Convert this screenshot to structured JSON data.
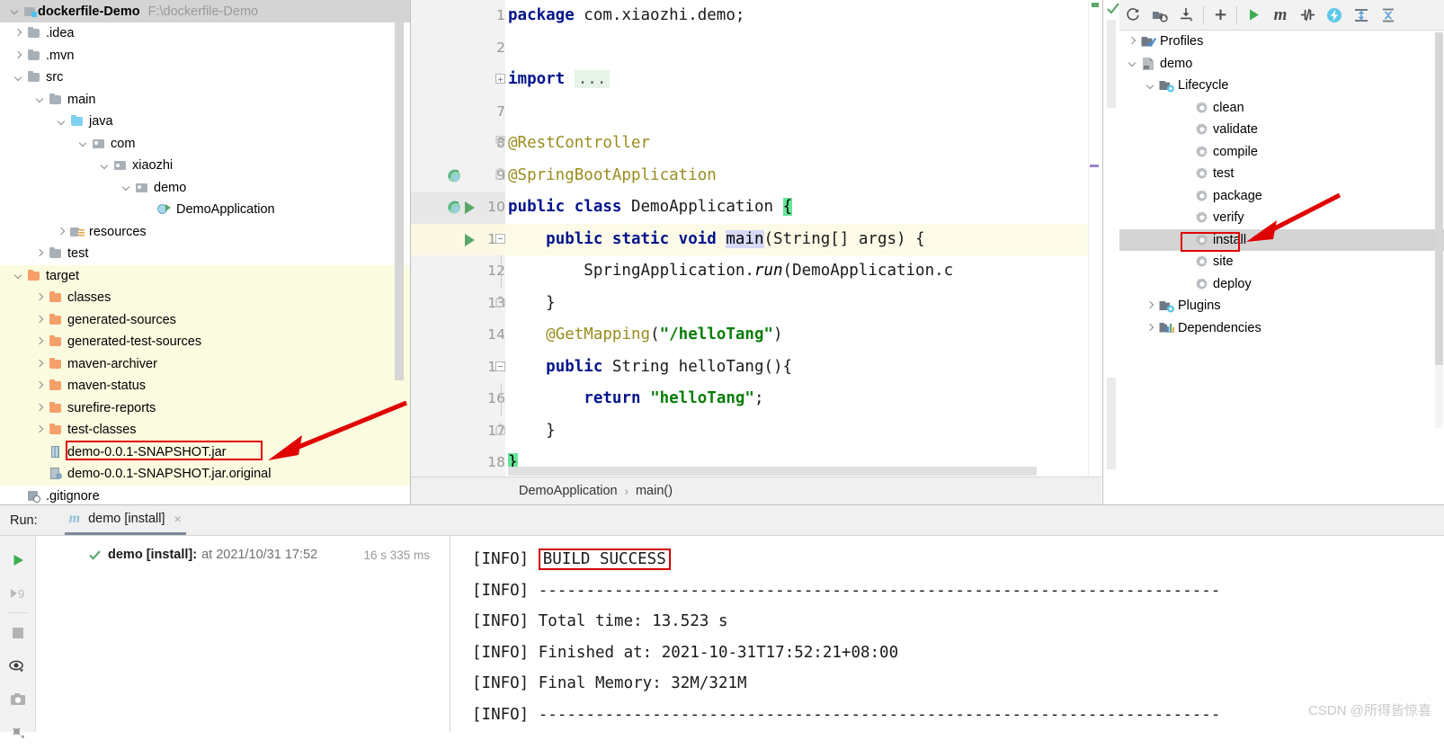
{
  "project": {
    "title": "dockerfile-Demo",
    "path": "F:\\dockerfile-Demo",
    "tree": [
      {
        "label": ".idea",
        "depth": 1,
        "arrow": "collapsed",
        "icon": "folder",
        "highlight": false
      },
      {
        "label": ".mvn",
        "depth": 1,
        "arrow": "collapsed",
        "icon": "folder",
        "highlight": false
      },
      {
        "label": "src",
        "depth": 1,
        "arrow": "expanded",
        "icon": "folder",
        "highlight": false
      },
      {
        "label": "main",
        "depth": 2,
        "arrow": "expanded",
        "icon": "folder",
        "highlight": false
      },
      {
        "label": "java",
        "depth": 3,
        "arrow": "expanded",
        "icon": "folder-src",
        "highlight": false
      },
      {
        "label": "com",
        "depth": 4,
        "arrow": "expanded",
        "icon": "pkg",
        "highlight": false
      },
      {
        "label": "xiaozhi",
        "depth": 5,
        "arrow": "expanded",
        "icon": "pkg",
        "highlight": false
      },
      {
        "label": "demo",
        "depth": 6,
        "arrow": "expanded",
        "icon": "pkg",
        "highlight": false
      },
      {
        "label": "DemoApplication",
        "depth": 7,
        "arrow": "none",
        "icon": "cls",
        "highlight": false
      },
      {
        "label": "resources",
        "depth": 3,
        "arrow": "collapsed",
        "icon": "res",
        "highlight": false
      },
      {
        "label": "test",
        "depth": 2,
        "arrow": "collapsed",
        "icon": "folder",
        "highlight": false
      },
      {
        "label": "target",
        "depth": 1,
        "arrow": "expanded",
        "icon": "folder-out",
        "highlight": true
      },
      {
        "label": "classes",
        "depth": 2,
        "arrow": "collapsed",
        "icon": "folder-out",
        "highlight": true
      },
      {
        "label": "generated-sources",
        "depth": 2,
        "arrow": "collapsed",
        "icon": "folder-out",
        "highlight": true
      },
      {
        "label": "generated-test-sources",
        "depth": 2,
        "arrow": "collapsed",
        "icon": "folder-out",
        "highlight": true
      },
      {
        "label": "maven-archiver",
        "depth": 2,
        "arrow": "collapsed",
        "icon": "folder-out",
        "highlight": true
      },
      {
        "label": "maven-status",
        "depth": 2,
        "arrow": "collapsed",
        "icon": "folder-out",
        "highlight": true
      },
      {
        "label": "surefire-reports",
        "depth": 2,
        "arrow": "collapsed",
        "icon": "folder-out",
        "highlight": true
      },
      {
        "label": "test-classes",
        "depth": 2,
        "arrow": "collapsed",
        "icon": "folder-out",
        "highlight": true
      },
      {
        "label": "demo-0.0.1-SNAPSHOT.jar",
        "depth": 2,
        "arrow": "none",
        "icon": "jar",
        "highlight": true
      },
      {
        "label": "demo-0.0.1-SNAPSHOT.jar.original",
        "depth": 2,
        "arrow": "none",
        "icon": "fgen",
        "highlight": true
      },
      {
        "label": ".gitignore",
        "depth": 1,
        "arrow": "none",
        "icon": "git",
        "highlight": false
      }
    ]
  },
  "editor": {
    "lines": [
      {
        "num": "1",
        "tokens": [
          {
            "t": "package",
            "c": "kw"
          },
          {
            "t": " com.xiaozhi.demo;",
            "c": "plain"
          }
        ]
      },
      {
        "num": "2",
        "tokens": []
      },
      {
        "num": "3",
        "tokens": [
          {
            "t": "import",
            "c": "kw"
          },
          {
            "t": " ",
            "c": "plain"
          },
          {
            "t": "...",
            "c": "ellipsis"
          }
        ],
        "fold": "plus"
      },
      {
        "num": "7",
        "tokens": []
      },
      {
        "num": "8",
        "tokens": [
          {
            "t": "@RestController",
            "c": "ann"
          }
        ],
        "foldcap": "start"
      },
      {
        "num": "9",
        "tokens": [
          {
            "t": "@SpringBootApplication",
            "c": "ann"
          }
        ],
        "gutterIcon": "bean",
        "foldcap": "mid"
      },
      {
        "num": "10",
        "tokens": [
          {
            "t": "public class",
            "c": "kw"
          },
          {
            "t": " DemoApplication ",
            "c": "plain"
          },
          {
            "t": "{",
            "c": "brace-hl"
          }
        ],
        "gutterIcon": "bean-run",
        "activeGutter": true
      },
      {
        "num": "11",
        "tokens": [
          {
            "t": "    ",
            "c": "plain"
          },
          {
            "t": "public static void",
            "c": "kw"
          },
          {
            "t": " ",
            "c": "plain"
          },
          {
            "t": "main",
            "c": "sel"
          },
          {
            "t": "(String[] args) {",
            "c": "plain"
          }
        ],
        "gutterIcon": "run",
        "highlight": true,
        "fold": "minus"
      },
      {
        "num": "12",
        "tokens": [
          {
            "t": "        SpringApplication.",
            "c": "plain"
          },
          {
            "t": "run",
            "c": "ital"
          },
          {
            "t": "(DemoApplication.c",
            "c": "plain"
          }
        ]
      },
      {
        "num": "13",
        "tokens": [
          {
            "t": "    }",
            "c": "plain"
          }
        ],
        "foldcap": "end"
      },
      {
        "num": "14",
        "tokens": [
          {
            "t": "    ",
            "c": "plain"
          },
          {
            "t": "@GetMapping",
            "c": "ann"
          },
          {
            "t": "(",
            "c": "plain"
          },
          {
            "t": "\"/helloTang\"",
            "c": "str"
          },
          {
            "t": ")",
            "c": "plain"
          }
        ]
      },
      {
        "num": "15",
        "tokens": [
          {
            "t": "    ",
            "c": "plain"
          },
          {
            "t": "public",
            "c": "kw"
          },
          {
            "t": " String helloTang(){",
            "c": "plain"
          }
        ],
        "fold": "minus"
      },
      {
        "num": "16",
        "tokens": [
          {
            "t": "        ",
            "c": "plain"
          },
          {
            "t": "return",
            "c": "kw"
          },
          {
            "t": " ",
            "c": "plain"
          },
          {
            "t": "\"helloTang\"",
            "c": "str"
          },
          {
            "t": ";",
            "c": "plain"
          }
        ]
      },
      {
        "num": "17",
        "tokens": [
          {
            "t": "    }",
            "c": "plain"
          }
        ],
        "foldcap": "end"
      },
      {
        "num": "18",
        "tokens": [
          {
            "t": "}",
            "c": "brace-hl"
          }
        ]
      }
    ],
    "breadcrumb": {
      "class": "DemoApplication",
      "separator": "›",
      "method": "main()"
    }
  },
  "maven": {
    "toolbar": [
      {
        "name": "reload-all-maven-projects-icon"
      },
      {
        "name": "generate-sources-icon"
      },
      {
        "name": "download-sources-icon"
      },
      {
        "name": "add-maven-project-icon"
      },
      {
        "name": "run-maven-build-icon"
      },
      {
        "name": "execute-maven-goal-icon"
      },
      {
        "name": "toggle-skip-tests-icon"
      },
      {
        "name": "toggle-offline-mode-icon"
      },
      {
        "name": "expand-all-icon"
      },
      {
        "name": "collapse-all-icon"
      }
    ],
    "tree": [
      {
        "label": "Profiles",
        "depth": 1,
        "arrow": "collapsed",
        "icon": "profiles",
        "selected": false
      },
      {
        "label": "demo",
        "depth": 1,
        "arrow": "expanded",
        "icon": "maven",
        "selected": false
      },
      {
        "label": "Lifecycle",
        "depth": 2,
        "arrow": "expanded",
        "icon": "phase-dir",
        "selected": false
      },
      {
        "label": "clean",
        "depth": 4,
        "arrow": "none",
        "icon": "gear",
        "selected": false
      },
      {
        "label": "validate",
        "depth": 4,
        "arrow": "none",
        "icon": "gear",
        "selected": false
      },
      {
        "label": "compile",
        "depth": 4,
        "arrow": "none",
        "icon": "gear",
        "selected": false
      },
      {
        "label": "test",
        "depth": 4,
        "arrow": "none",
        "icon": "gear",
        "selected": false
      },
      {
        "label": "package",
        "depth": 4,
        "arrow": "none",
        "icon": "gear",
        "selected": false
      },
      {
        "label": "verify",
        "depth": 4,
        "arrow": "none",
        "icon": "gear",
        "selected": false
      },
      {
        "label": "install",
        "depth": 4,
        "arrow": "none",
        "icon": "gear",
        "selected": true
      },
      {
        "label": "site",
        "depth": 4,
        "arrow": "none",
        "icon": "gear",
        "selected": false
      },
      {
        "label": "deploy",
        "depth": 4,
        "arrow": "none",
        "icon": "gear",
        "selected": false
      },
      {
        "label": "Plugins",
        "depth": 2,
        "arrow": "collapsed",
        "icon": "phase-dir",
        "selected": false
      },
      {
        "label": "Dependencies",
        "depth": 2,
        "arrow": "collapsed",
        "icon": "deps",
        "selected": false
      }
    ]
  },
  "run": {
    "label": "Run:",
    "tab": {
      "icon_glyph": "m",
      "name": "demo [install]",
      "close": "×"
    },
    "side_buttons": [
      {
        "name": "rerun-button"
      },
      {
        "name": "rerun-failed-tests-button"
      },
      {
        "name": "stop-button"
      },
      {
        "name": "toggle-visibility-button"
      },
      {
        "name": "export-screenshot-button"
      },
      {
        "name": "thread-dump-button"
      }
    ],
    "tree_row": {
      "name": "demo [install]:",
      "at": "at 2021/10/31 17:52",
      "duration": "16 s 335 ms"
    },
    "console": [
      {
        "prefix": "[INFO] ",
        "text": "BUILD SUCCESS",
        "boxed": true
      },
      {
        "prefix": "[INFO] ",
        "text": "------------------------------------------------------------------------",
        "boxed": false
      },
      {
        "prefix": "[INFO] ",
        "text": "Total time: 13.523 s",
        "boxed": false
      },
      {
        "prefix": "[INFO] ",
        "text": "Finished at: 2021-10-31T17:52:21+08:00",
        "boxed": false
      },
      {
        "prefix": "[INFO] ",
        "text": "Final Memory: 32M/321M",
        "boxed": false
      },
      {
        "prefix": "[INFO] ",
        "text": "------------------------------------------------------------------------",
        "boxed": false
      }
    ]
  },
  "watermark": "CSDN @所得皆惊喜",
  "colors": {
    "annotation_red": "#e00000",
    "selection_grey": "#d4d4d4",
    "target_folder_bg": "#fbfbe0",
    "keyword_blue": "#00148c",
    "annotation_olive": "#9a8c1e",
    "string_green": "#077d07",
    "brace_match_green": "#64e596"
  }
}
